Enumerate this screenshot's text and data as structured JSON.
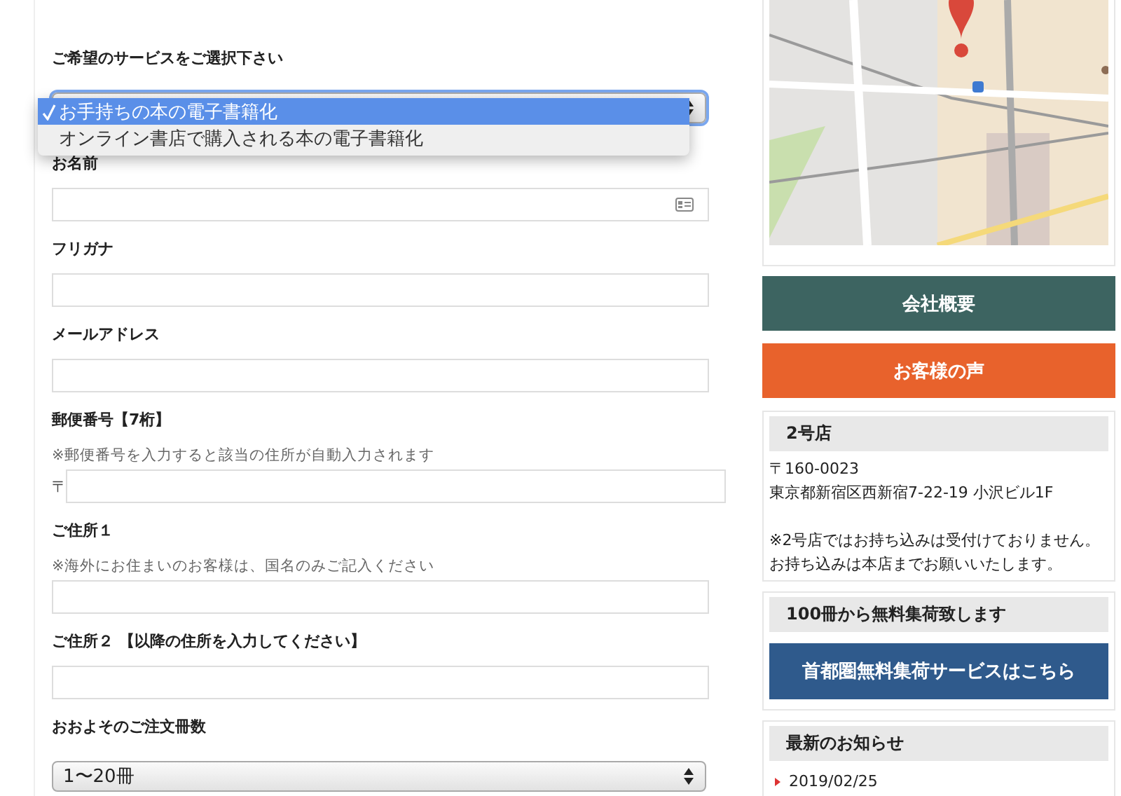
{
  "form": {
    "fields": [
      {
        "kind": "select",
        "label": "ご希望のサービスをご選択下さい",
        "focused": true,
        "options": [
          {
            "label": "お手持ちの本の電子書籍化",
            "selected": true
          },
          {
            "label": "オンライン書店で購入される本の電子書籍化",
            "selected": false
          }
        ]
      },
      {
        "kind": "text",
        "label": "お名前",
        "autofill": true
      },
      {
        "kind": "text",
        "label": "フリガナ",
        "autofill": false
      },
      {
        "kind": "text",
        "label": "メールアドレス",
        "autofill": false
      },
      {
        "kind": "postal",
        "label": "郵便番号【7桁】",
        "note": "※郵便番号を入力すると該当の住所が自動入力されます",
        "prefix": "〒"
      },
      {
        "kind": "text",
        "label": "ご住所１",
        "note": "※海外にお住まいのお客様は、国名のみご記入ください",
        "autofill": false
      },
      {
        "kind": "text",
        "label": "ご住所２ 【以降の住所を入力してください】",
        "autofill": false
      },
      {
        "kind": "select",
        "label": "おおよそのご注文冊数",
        "focused": false,
        "value": "1〜20冊"
      }
    ]
  },
  "sidebar": {
    "links": [
      {
        "label": "会社概要",
        "color": "#3d6461"
      },
      {
        "label": "お客様の声",
        "color": "#e8622c"
      }
    ],
    "store": {
      "heading": "2号店",
      "lines": [
        "〒160-0023",
        "東京都新宿区西新宿7-22-19 小沢ビル1F"
      ],
      "notes": [
        "※2号店ではお持ち込みは受付けておりません。",
        "お持ち込みは本店までお願いいたします。"
      ]
    },
    "pickup": {
      "heading": "100冊から無料集荷致します",
      "button": {
        "label": "首都圏無料集荷サービスはこちら",
        "color": "#2f5a8c"
      }
    },
    "news": {
      "heading": "最新のお知らせ",
      "items": [
        {
          "date": "2019/02/25"
        }
      ]
    }
  }
}
